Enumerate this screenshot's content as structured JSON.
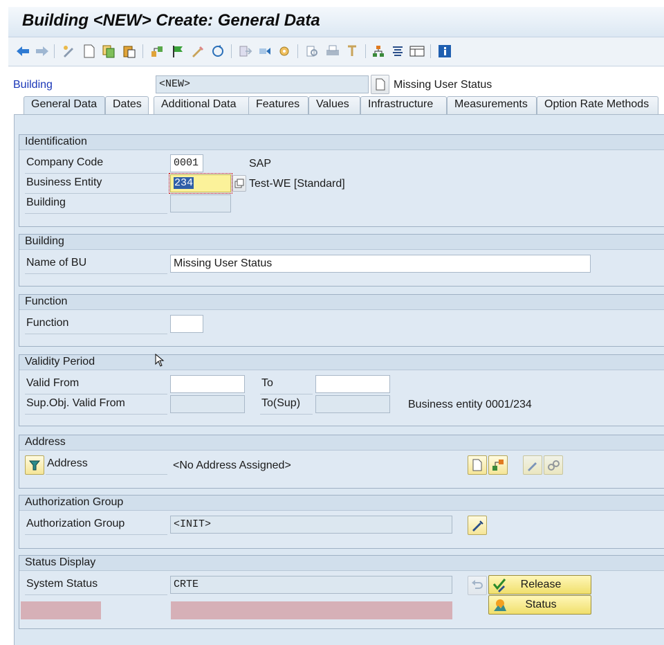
{
  "window": {
    "title": "Building <NEW> Create: General Data"
  },
  "toolbar": {
    "icons": [
      "back-icon",
      "forward-icon",
      "display-change-icon",
      "create-icon",
      "copy-icon",
      "paste-icon",
      "other-object-icon",
      "flag-icon",
      "edit-icon",
      "refresh-icon",
      "export-icon",
      "send-icon",
      "settings-icon",
      "print-preview-icon",
      "print-icon",
      "find-icon",
      "hierarchy-icon",
      "list-icon",
      "table-icon",
      "info-icon"
    ]
  },
  "header": {
    "object_label": "Building",
    "object_value": "<NEW>",
    "object_name": "Missing User Status"
  },
  "tabs": [
    {
      "label": "General Data",
      "active": true
    },
    {
      "label": "Dates"
    },
    {
      "label": "Additional Data"
    },
    {
      "label": "Features"
    },
    {
      "label": "Values"
    },
    {
      "label": "Infrastructure"
    },
    {
      "label": "Measurements"
    },
    {
      "label": "Option Rate Methods"
    }
  ],
  "identification": {
    "title": "Identification",
    "company_code_label": "Company Code",
    "company_code_value": "0001",
    "company_code_text": "SAP",
    "business_entity_label": "Business Entity",
    "business_entity_value": "234",
    "business_entity_text": "Test-WE [Standard]",
    "building_label": "Building",
    "building_value": ""
  },
  "building": {
    "title": "Building",
    "name_label": "Name of BU",
    "name_value": "Missing User Status"
  },
  "function": {
    "title": "Function",
    "function_label": "Function",
    "function_value": ""
  },
  "validity": {
    "title": "Validity Period",
    "valid_from_label": "Valid From",
    "valid_from_value": "",
    "to_label": "To",
    "to_value": "",
    "sup_from_label": "Sup.Obj. Valid From",
    "sup_from_value": "",
    "sup_to_label": "To(Sup)",
    "sup_to_value": "",
    "sup_text": "Business entity 0001/234"
  },
  "address": {
    "title": "Address",
    "label": "Address",
    "value": "<No Address Assigned>"
  },
  "authorization": {
    "title": "Authorization Group",
    "label": "Authorization Group",
    "value": "<INIT>"
  },
  "status": {
    "title": "Status Display",
    "system_status_label": "System Status",
    "system_status_value": "CRTE",
    "release_label": "Release",
    "status_label": "Status"
  },
  "colors": {
    "panel": "#dbe7f2",
    "link": "#1b37b8",
    "button": "#f0df6c",
    "error_bar": "#d6b0b7"
  }
}
